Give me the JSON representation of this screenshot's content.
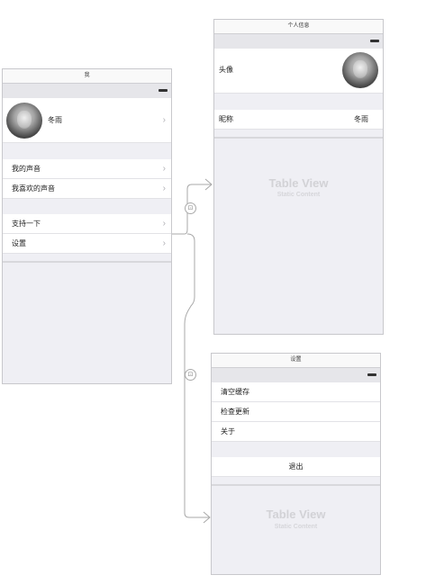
{
  "me_screen": {
    "title": "我",
    "profile_name": "冬雨",
    "items_group1": [
      "我的声音",
      "我喜欢的声音"
    ],
    "items_group2": [
      "支持一下",
      "设置"
    ]
  },
  "profile_screen": {
    "title": "个人信息",
    "avatar_label": "头像",
    "nickname_label": "昵称",
    "nickname_value": "冬雨",
    "placeholder_title": "Table View",
    "placeholder_sub": "Static Content"
  },
  "settings_screen": {
    "title": "设置",
    "items": [
      "清空缓存",
      "检查更新",
      "关于"
    ],
    "logout_label": "退出",
    "placeholder_title": "Table View",
    "placeholder_sub": "Static Content"
  },
  "icons": {
    "chevron": "chevron-right-icon",
    "segue": "segue-icon"
  }
}
